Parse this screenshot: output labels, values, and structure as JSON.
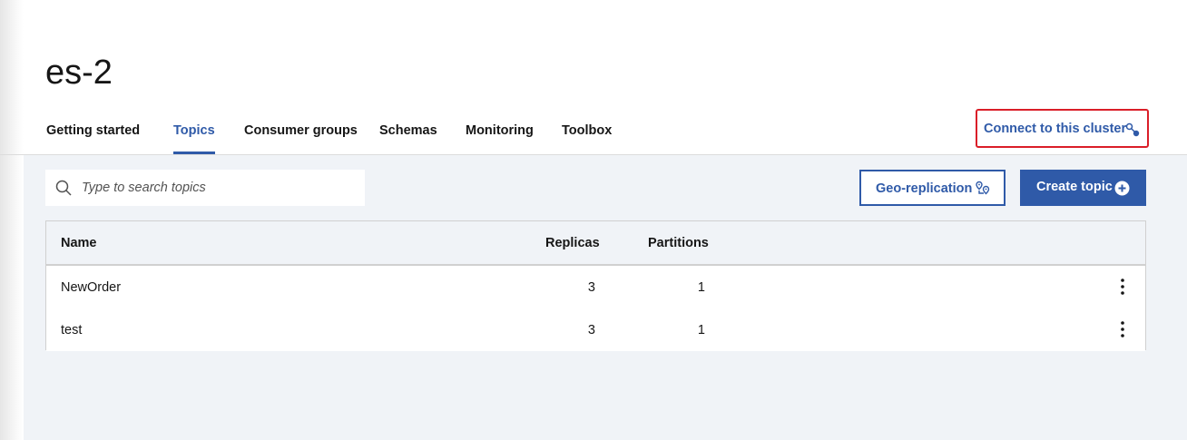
{
  "cluster": {
    "name": "es-2"
  },
  "tabs": [
    {
      "label": "Getting started",
      "active": false
    },
    {
      "label": "Topics",
      "active": true
    },
    {
      "label": "Consumer groups",
      "active": false
    },
    {
      "label": "Schemas",
      "active": false
    },
    {
      "label": "Monitoring",
      "active": false
    },
    {
      "label": "Toolbox",
      "active": false
    }
  ],
  "connect": {
    "label": "Connect to this cluster",
    "icon": "connection-icon"
  },
  "search": {
    "placeholder": "Type to search topics",
    "value": "",
    "icon": "search-icon"
  },
  "actions": {
    "geo_label": "Geo-replication",
    "geo_icon": "geo-replication-icon",
    "create_label": "Create topic",
    "create_icon": "add-filled-icon"
  },
  "table": {
    "columns": {
      "name": "Name",
      "replicas": "Replicas",
      "partitions": "Partitions"
    },
    "rows": [
      {
        "name": "NewOrder",
        "replicas": "3",
        "partitions": "1"
      },
      {
        "name": "test",
        "replicas": "3",
        "partitions": "1"
      }
    ],
    "row_menu_icon": "overflow-menu-icon"
  },
  "colors": {
    "accent": "#2f5aa8",
    "highlight_border": "#da1e28",
    "content_bg": "#f0f3f7",
    "text": "#161616"
  }
}
